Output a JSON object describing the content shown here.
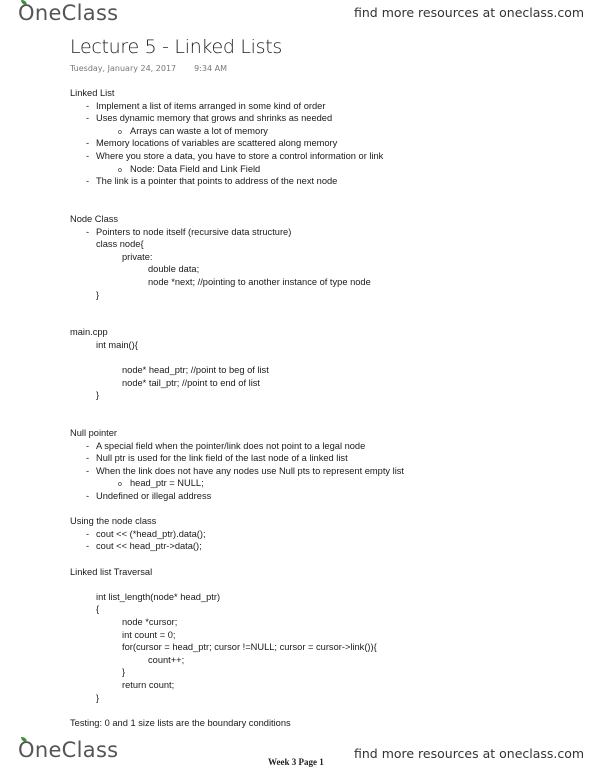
{
  "header": {
    "logo_text": "neClass",
    "logo_first": "O",
    "find_more": "find more resources at oneclass.com"
  },
  "doc": {
    "title": "Lecture 5 - Linked Lists",
    "date": "Tuesday, January 24, 2017",
    "time": "9:34 AM"
  },
  "sections": {
    "linked_list": {
      "heading": "Linked List",
      "items": [
        "Implement a list of items arranged in some kind of order",
        "Uses dynamic memory that grows and shrinks as needed",
        "Arrays can waste a lot of memory",
        "Memory locations of variables are scattered along memory",
        "Where you store a data, you have to store a control information or link",
        "Node: Data Field and Link Field",
        "The link is a pointer that points to address of the next node"
      ]
    },
    "node_class": {
      "heading": "Node Class",
      "items": [
        "Pointers to node itself (recursive data structure)",
        "class node{",
        "private:",
        "double data;",
        "node *next; //pointing to another instance of type node",
        "}"
      ]
    },
    "main_cpp": {
      "heading": "main.cpp",
      "items": [
        "int main(){",
        "node* head_ptr; //point to beg of list",
        "node* tail_ptr; //point to end of list",
        "}"
      ]
    },
    "null_pointer": {
      "heading": "Null pointer",
      "items": [
        "A special field when the pointer/link does not point to a legal node",
        "Null ptr is used for the link field of the last node of a linked list",
        "When the link does not have any nodes use Null pts to represent empty list",
        "head_ptr = NULL;",
        "Undefined or illegal address"
      ]
    },
    "using_node": {
      "heading": "Using the node class",
      "items": [
        "cout << (*head_ptr).data();",
        "cout << head_ptr->data();"
      ]
    },
    "traversal": {
      "heading": "Linked list Traversal",
      "code": [
        "int list_length(node* head_ptr)",
        "{",
        "node *cursor;",
        "int count = 0;",
        "for(cursor = head_ptr; cursor !=NULL; cursor = cursor->link()){",
        "count++;",
        "}",
        "return count;",
        "}"
      ]
    },
    "testing": "Testing: 0 and 1 size lists are the boundary conditions"
  },
  "footer": {
    "page_label": "Week 3 Page 1",
    "find_more": "find more resources at oneclass.com"
  },
  "symbols": {
    "dash": "-",
    "circle": "o"
  }
}
